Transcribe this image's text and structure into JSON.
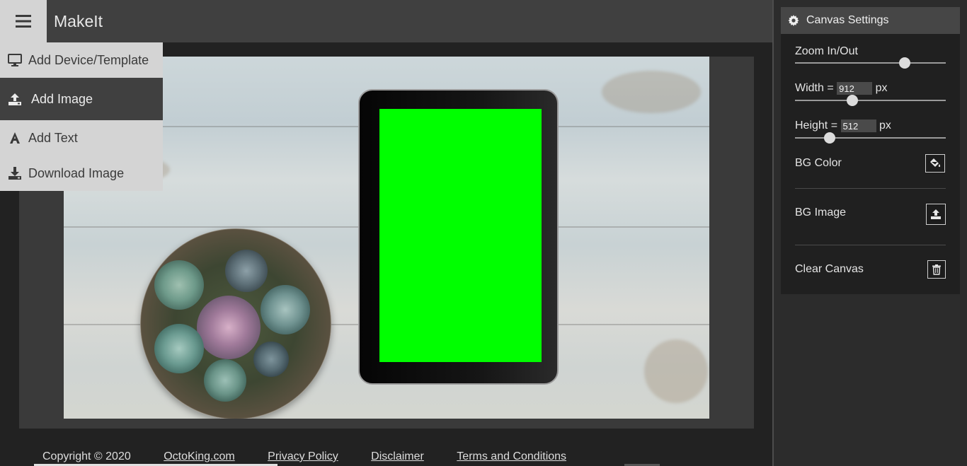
{
  "app": {
    "title": "MakeIt"
  },
  "menu": {
    "items": [
      {
        "label": "Add Device/Template",
        "icon": "monitor-icon"
      },
      {
        "label": "Add Image",
        "icon": "upload-icon",
        "active": true
      },
      {
        "label": "Add Text",
        "icon": "font-icon"
      },
      {
        "label": "Download Image",
        "icon": "download-icon"
      }
    ]
  },
  "canvas_settings": {
    "title": "Canvas Settings",
    "zoom_label": "Zoom In/Out",
    "zoom_level": 0.73,
    "width_label": "Width =",
    "width_value": "912",
    "width_unit": "px",
    "width_slider": 0.38,
    "height_label": "Height =",
    "height_value": "512",
    "height_unit": "px",
    "height_slider": 0.23,
    "bg_color_label": "BG Color",
    "bg_image_label": "BG Image",
    "clear_label": "Clear Canvas"
  },
  "footer": {
    "copyright": "Copyright © 2020",
    "links": [
      "OctoKing.com",
      "Privacy Policy",
      "Disclaimer",
      "Terms and Conditions"
    ]
  },
  "colors": {
    "device_screen": "#00ff00",
    "header_bg": "#404040",
    "menu_bg": "#d4d4d4"
  }
}
